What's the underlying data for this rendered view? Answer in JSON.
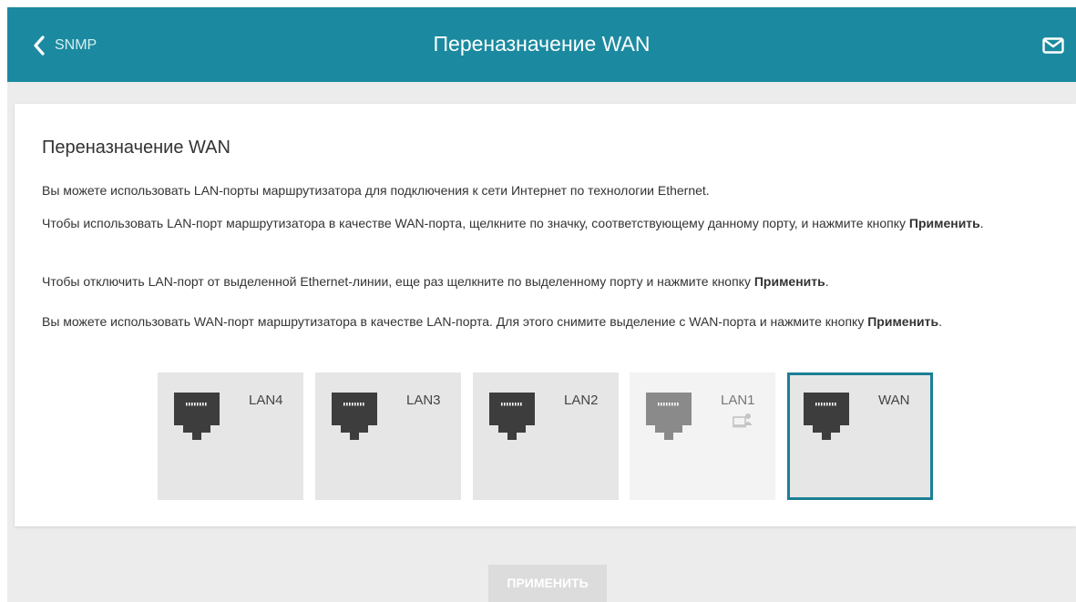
{
  "header": {
    "back_label": "SNMP",
    "title": "Переназначение WAN",
    "icons": {
      "back": "chevron-left-icon",
      "mail": "mail-icon"
    },
    "color": "#1b8aa0"
  },
  "card": {
    "title": "Переназначение WAN",
    "paragraphs": [
      {
        "text": "Вы можете использовать LAN-порты маршрутизатора для подключения к сети Интернет по технологии Ethernet.",
        "bold": "",
        "tail": ""
      },
      {
        "text": "Чтобы использовать LAN-порт маршрутизатора в качестве WAN-порта, щелкните по значку, соответствующему данному порту, и нажмите кнопку ",
        "bold": "Применить",
        "tail": "."
      },
      {
        "text": "Чтобы отключить LAN-порт от выделенной Ethernet-линии, еще раз щелкните по выделенному порту и нажмите кнопку ",
        "bold": "Применить",
        "tail": "."
      },
      {
        "text": "Вы можете использовать WAN-порт маршрутизатора в качестве LAN-порта. Для этого снимите выделение с WAN-порта и нажмите кнопку ",
        "bold": "Применить",
        "tail": "."
      }
    ]
  },
  "ports": [
    {
      "label": "LAN4",
      "state": "normal",
      "icon": "ethernet-port-icon"
    },
    {
      "label": "LAN3",
      "state": "normal",
      "icon": "ethernet-port-icon"
    },
    {
      "label": "LAN2",
      "state": "normal",
      "icon": "ethernet-port-icon"
    },
    {
      "label": "LAN1",
      "state": "disabled",
      "icon": "ethernet-port-icon",
      "sub_icon": "computer-user-icon"
    },
    {
      "label": "WAN",
      "state": "selected",
      "icon": "ethernet-port-icon"
    }
  ],
  "apply_button": {
    "label": "ПРИМЕНИТЬ",
    "enabled": false
  },
  "colors": {
    "accent": "#1b8aa0",
    "selected_border": "#1b7f94",
    "port_active": "#3d3d3d",
    "port_disabled": "#8a8a8a"
  }
}
